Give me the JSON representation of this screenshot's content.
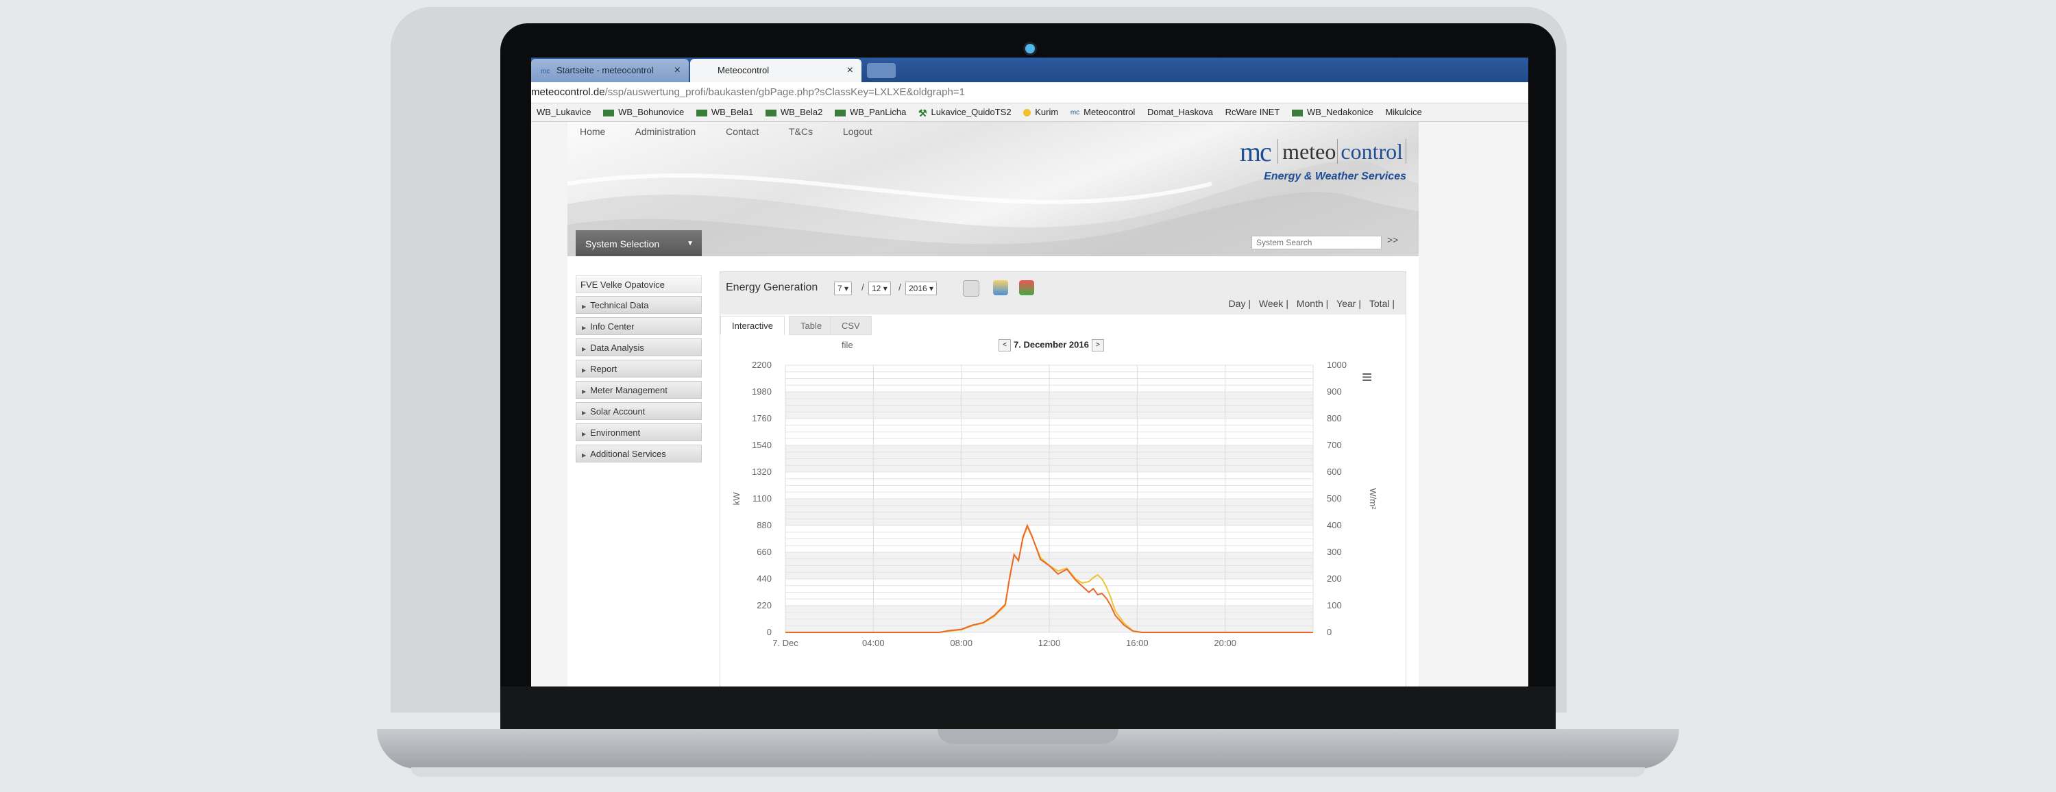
{
  "browser": {
    "tabs": [
      {
        "label": "Startseite - meteocontrol",
        "favicon": "mc"
      },
      {
        "label": "Meteocontrol",
        "favicon": ""
      }
    ],
    "address": {
      "host": "meteocontrol.de",
      "path": "/ssp/auswertung_profi/baukasten/gbPage.php?sClassKey=LXLXE&oldgraph=1"
    },
    "bookmarks": [
      "WB_Lukavice",
      "WB_Bohunovice",
      "WB_Bela1",
      "WB_Bela2",
      "WB_PanLicha",
      "Lukavice_QuidoTS2",
      "Kurim",
      "Meteocontrol",
      "Domat_Haskova",
      "RcWare INET",
      "WB_Nedakonice",
      "Mikulcice"
    ]
  },
  "site": {
    "nav": [
      "Home",
      "Administration",
      "Contact",
      "T&Cs",
      "Logout"
    ],
    "logo": {
      "mark": "mc",
      "word1": "meteo",
      "word2": "control",
      "tagline": "Energy & Weather Services"
    },
    "system_selection": "System Selection",
    "search_placeholder": "System Search",
    "search_go": ">>"
  },
  "sidebar": {
    "title": "FVE Velke Opatovice",
    "items": [
      "Technical Data",
      "Info Center",
      "Data Analysis",
      "Report",
      "Meter Management",
      "Solar Account",
      "Environment",
      "Additional Services"
    ]
  },
  "panel": {
    "title": "Energy Generation",
    "day": "7",
    "month": "12",
    "year": "2016",
    "periods": [
      "Day |",
      "Week |",
      "Month |",
      "Year |",
      "Total |"
    ],
    "tabs": [
      "Interactive",
      "Table",
      "CSV file"
    ],
    "date_label": "7. December 2016"
  },
  "chart_data": {
    "type": "line",
    "x_ticks": [
      "7. Dec",
      "04:00",
      "08:00",
      "12:00",
      "16:00",
      "20:00"
    ],
    "y_left": {
      "label": "kW",
      "ticks": [
        0,
        220,
        440,
        660,
        880,
        1100,
        1320,
        1540,
        1760,
        1980,
        2200
      ],
      "range": [
        0,
        2200
      ]
    },
    "y_right": {
      "label": "W/m²",
      "ticks": [
        0,
        100,
        200,
        300,
        400,
        500,
        600,
        700,
        800,
        900,
        1000
      ],
      "range": [
        0,
        1000
      ]
    },
    "grid": true,
    "series": [
      {
        "color": "#e8692a",
        "axis": "left",
        "x": [
          0,
          7,
          7.5,
          8,
          8.5,
          9,
          9.5,
          10,
          10.2,
          10.4,
          10.6,
          10.8,
          11,
          11.2,
          11.4,
          11.6,
          12,
          12.4,
          12.8,
          13.2,
          13.5,
          13.8,
          14,
          14.2,
          14.4,
          14.6,
          14.8,
          15,
          15.4,
          15.8,
          16.2,
          24
        ],
        "y": [
          0,
          0,
          15,
          25,
          60,
          80,
          140,
          230,
          450,
          640,
          590,
          780,
          880,
          800,
          700,
          600,
          550,
          480,
          520,
          430,
          380,
          330,
          360,
          310,
          320,
          280,
          220,
          140,
          60,
          10,
          0,
          0
        ]
      },
      {
        "color": "#f1c232",
        "axis": "right",
        "x": [
          0,
          7,
          7.5,
          8,
          8.5,
          9,
          9.5,
          10,
          10.2,
          10.4,
          10.6,
          10.8,
          11,
          11.2,
          11.4,
          11.6,
          12,
          12.4,
          12.8,
          13.2,
          13.5,
          13.8,
          14,
          14.2,
          14.4,
          14.6,
          14.8,
          15,
          15.4,
          15.8,
          16.2,
          24
        ],
        "y": [
          0,
          0,
          5,
          10,
          25,
          35,
          60,
          100,
          210,
          290,
          270,
          350,
          395,
          360,
          320,
          280,
          250,
          230,
          240,
          200,
          185,
          190,
          205,
          215,
          200,
          170,
          130,
          80,
          35,
          6,
          0,
          0
        ]
      }
    ]
  }
}
